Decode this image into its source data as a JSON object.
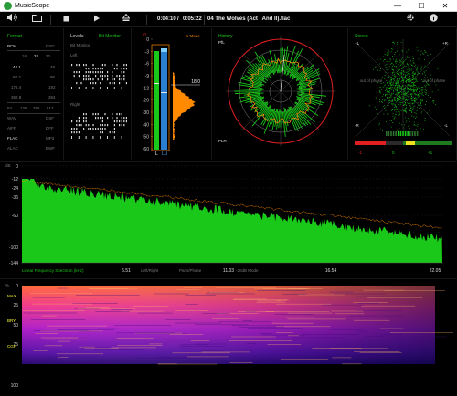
{
  "window": {
    "title": "MusicScope",
    "minimize": "—",
    "maximize": "☐",
    "close": "✕"
  },
  "toolbar": {
    "time_elapsed": "0:04:10",
    "time_sep": "/",
    "time_total": "0:05:22",
    "track": "04 The Wolves (Act I And II).flac",
    "icons": [
      "volume-icon",
      "open-folder-icon",
      "stop-icon",
      "play-icon",
      "eject-icon",
      "gear-icon",
      "info-icon"
    ]
  },
  "format": {
    "title": "Format",
    "codec_left": "PCM",
    "codec_right": "DSD",
    "bits": [
      "16",
      "24",
      "32"
    ],
    "rates_left": [
      "44.1",
      "88.2",
      "176.4",
      "352.8"
    ],
    "rates_right": [
      "48",
      "96",
      "192",
      "384"
    ],
    "dsd_rates": [
      "64",
      "128",
      "256",
      "512"
    ],
    "containers": [
      [
        "WAV",
        "DSF"
      ],
      [
        "AIFF",
        "DFF"
      ],
      [
        "FLAC",
        "MP3"
      ],
      [
        "ALAC",
        "BWF"
      ]
    ]
  },
  "levels": {
    "title": "Levels",
    "mode": "Bit Monitor",
    "bit_monitor_label": "Bit Monitor",
    "left_label": "Left",
    "right_label": "Right"
  },
  "meter": {
    "s_mode": "S-Mode",
    "ticks": [
      "0",
      "-3",
      "-6",
      "-9",
      "-12",
      "-20",
      "-30",
      "-40",
      "-50",
      "-60"
    ],
    "top_value": "0",
    "peak_value": "18.0",
    "bottom_left": "L",
    "bottom_right": "LU"
  },
  "history": {
    "title": "History",
    "pl_label": "PfL",
    "plr_label": "PLR"
  },
  "stereo": {
    "title": "Stereo",
    "top_left": "+L",
    "top_right": "+R",
    "bottom_left": "-R",
    "bottom_right": "-L",
    "out_of_phase_left": "out of phase",
    "out_of_phase_right": "out of phase",
    "scale_left": "-1",
    "scale_mid": "0",
    "scale_right": "+1"
  },
  "spectrum": {
    "unit": "dB",
    "y_ticks": [
      "0",
      "-12",
      "-24",
      "-36",
      "-60",
      "-100",
      "-144"
    ],
    "x_label": "Linear Frequency Spectrum (kHz)",
    "x_ticks": [
      "5.51",
      "11.03",
      "16.54",
      "22.05"
    ],
    "modes": [
      "Left/Right",
      "Pans/Phase",
      "-20dB Mode"
    ]
  },
  "spectrogram": {
    "unit": "%",
    "labels": [
      "MAX",
      "BRY",
      "CGF"
    ],
    "y_ticks": [
      "0",
      "25",
      "50",
      "75",
      "100"
    ]
  },
  "colors": {
    "accent_green": "#19c819",
    "orange": "#ff8a00",
    "red": "#e02020",
    "blue": "#46a8ff"
  }
}
